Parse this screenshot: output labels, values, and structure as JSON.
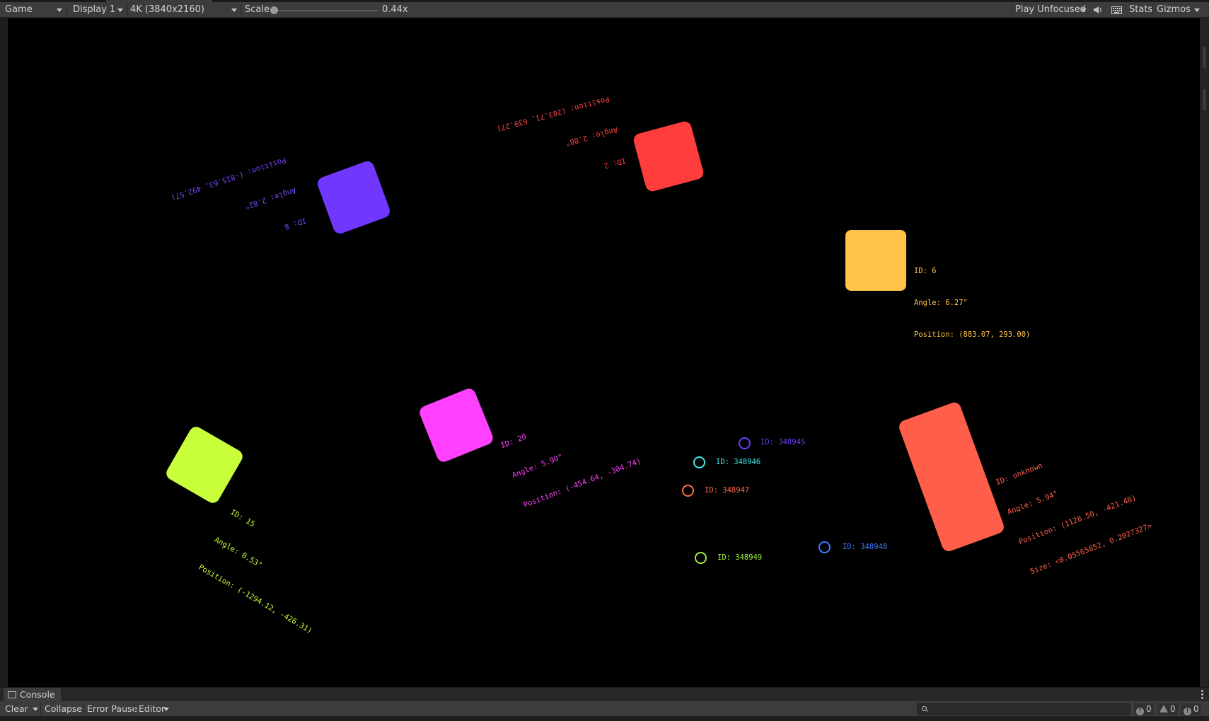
{
  "toolbar": {
    "view_mode": "Game",
    "display": "Display 1",
    "resolution": "4K (3840x2160)",
    "scale_label": "Scale",
    "scale_value": "0.44x",
    "play_mode": "Play Unfocused",
    "stats": "Stats",
    "gizmos": "Gizmos"
  },
  "scene": {
    "boxes": [
      {
        "id_text": "ID: 8",
        "angle_text": "Angle: 2.82°",
        "position_text": "Position: (-815.63, 492.57)",
        "color": "#7038ff"
      },
      {
        "id_text": "ID: 2",
        "angle_text": "Angle: 2.88°",
        "position_text": "Position: (203.71, 639.27)",
        "color": "#ff3d3d"
      },
      {
        "id_text": "ID: 6",
        "angle_text": "Angle: 6.27°",
        "position_text": "Position: (883.07, 293.00)",
        "color": "#ffc34a"
      },
      {
        "id_text": "ID: 20",
        "angle_text": "Angle: 5.90°",
        "position_text": "Position: (-454.64, -304.74)",
        "color": "#ff40ff"
      },
      {
        "id_text": "ID: 15",
        "angle_text": "Angle: 0.53°",
        "position_text": "Position: (-1294.12, -426.31)",
        "color": "#c8ff3a"
      },
      {
        "id_text": "ID: unknown",
        "angle_text": "Angle: 5.94°",
        "position_text": "Position: (1128.50, -421.48)",
        "size_text": "Size: <0.05565852, 0.2027327>",
        "color": "#ff5f4a"
      }
    ],
    "circles": [
      {
        "label": "ID: 348945",
        "color": "#6a3cff"
      },
      {
        "label": "ID: 348946",
        "color": "#3ee8e8"
      },
      {
        "label": "ID: 348947",
        "color": "#ff6a4a"
      },
      {
        "label": "ID: 348948",
        "color": "#3c7cff"
      },
      {
        "label": "ID: 348949",
        "color": "#a0f040"
      }
    ]
  },
  "console": {
    "tab_label": "Console",
    "clear": "Clear",
    "collapse": "Collapse",
    "error_pause": "Error Pause",
    "editor": "Editor",
    "info_count": "0",
    "warning_count": "0",
    "error_count": "0"
  }
}
